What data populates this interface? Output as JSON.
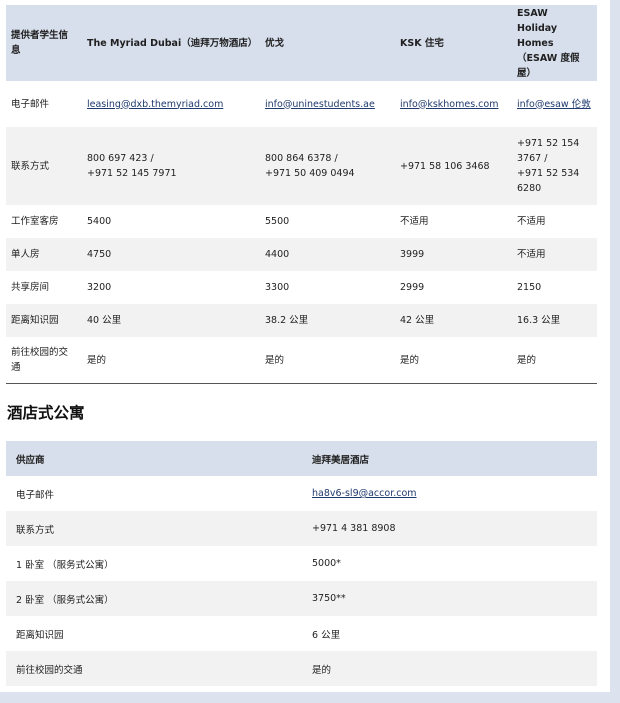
{
  "student_table": {
    "headers": [
      "提供者学生信息",
      "The Myriad Dubai（迪拜万物酒店）",
      "优戈",
      "KSK 住宅",
      "ESAW Holiday Homes （ESAW 度假屋）"
    ],
    "rows": [
      {
        "label": "电子邮件",
        "cells": [
          "leasing@dxb.themyriad.com",
          "info@uninestudents.ae",
          "info@kskhomes.com",
          "info@esaw 伦敦"
        ]
      },
      {
        "label": "联系方式",
        "cells": [
          "800 697 423 /\n+971 52 145 7971",
          "800 864 6378 /\n+971 50 409 0494",
          "+971 58 106 3468",
          "+971 52 154\n3767 /\n+971 52 534\n6280"
        ]
      },
      {
        "label": "工作室客房",
        "cells": [
          "5400",
          "5500",
          "不适用",
          "不适用"
        ]
      },
      {
        "label": "单人房",
        "cells": [
          "4750",
          "4400",
          "3999",
          "不适用"
        ]
      },
      {
        "label": "共享房间",
        "cells": [
          "3200",
          "3300",
          "2999",
          "2150"
        ]
      },
      {
        "label": "距离知识园",
        "cells": [
          "40 公里",
          "38.2 公里",
          "42 公里",
          "16.3 公里"
        ]
      },
      {
        "label": "前往校园的交通",
        "cells": [
          "是的",
          "是的",
          "是的",
          "是的"
        ]
      }
    ]
  },
  "section_title": "酒店式公寓",
  "hotel_table": {
    "headers": [
      "供应商",
      "迪拜美居酒店"
    ],
    "rows": [
      [
        "电子邮件",
        "ha8v6-sl9@accor.com"
      ],
      [
        "联系方式",
        "+971 4 381 8908"
      ],
      [
        "1 卧室 （服务式公寓）",
        "5000*"
      ],
      [
        "2 卧室 （服务式公寓）",
        "3750**"
      ],
      [
        "距离知识园",
        "6 公里"
      ],
      [
        "前往校园的交通",
        "是的"
      ]
    ]
  }
}
